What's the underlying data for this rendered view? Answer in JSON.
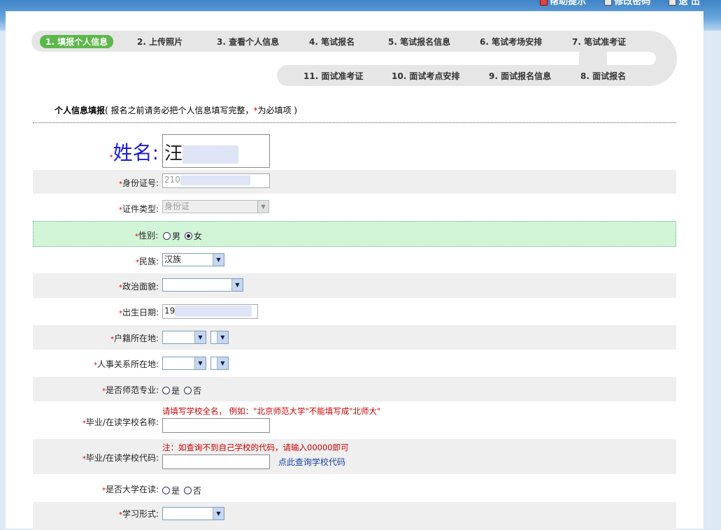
{
  "header": {
    "links": [
      "帮助提示",
      "修改密码",
      "退 出"
    ]
  },
  "steps": {
    "row1": [
      "1. 填报个人信息",
      "2. 上传照片",
      "3. 查看个人信息",
      "4. 笔试报名",
      "5. 笔试报名信息",
      "6. 笔试考场安排",
      "7. 笔试准考证"
    ],
    "row2": [
      "11. 面试准考证",
      "10. 面试考点安排",
      "9. 面试报名信息",
      "8. 面试报名"
    ]
  },
  "section": {
    "title": "个人信息填报",
    "note_prefix": "( 报名之前请务必把个人信息填写完整，",
    "note_req": "*",
    "note_suffix": "为必填项 )"
  },
  "form": {
    "req": "*",
    "name": {
      "label": "姓名:",
      "value": "汪"
    },
    "id_number": {
      "label": "身份证号:",
      "value": "210"
    },
    "id_type": {
      "label": "证件类型:",
      "value": "身份证"
    },
    "gender": {
      "label": "性别:",
      "options": [
        "男",
        "女"
      ],
      "selected": "女"
    },
    "ethnicity": {
      "label": "民族:",
      "value": "汉族"
    },
    "political": {
      "label": "政治面貌:",
      "value": ""
    },
    "birth_date": {
      "label": "出生日期:",
      "value": "19"
    },
    "hukou": {
      "label": "户籍所在地:"
    },
    "personnel": {
      "label": "人事关系所在地:"
    },
    "normal_major": {
      "label": "是否师范专业:",
      "options": [
        "是",
        "否"
      ],
      "selected": ""
    },
    "school_name": {
      "label": "毕业/在读学校名称:",
      "hint": "请填写学校全名， 例如：\"北京师范大学\"不能填写成\"北师大\"",
      "value": ""
    },
    "school_code": {
      "label": "毕业/在读学校代码:",
      "hint": "注：如查询不到自己学校的代码，请输入00000即可",
      "value": "",
      "link": "点此查询学校代码"
    },
    "in_university": {
      "label": "是否大学在读:",
      "options": [
        "是",
        "否"
      ],
      "selected": ""
    },
    "study_form": {
      "label": "学习形式:"
    }
  },
  "colors": {
    "active_step": "#5db84b",
    "required": "#dd0000",
    "highlight_row": "#d2f5d7"
  }
}
